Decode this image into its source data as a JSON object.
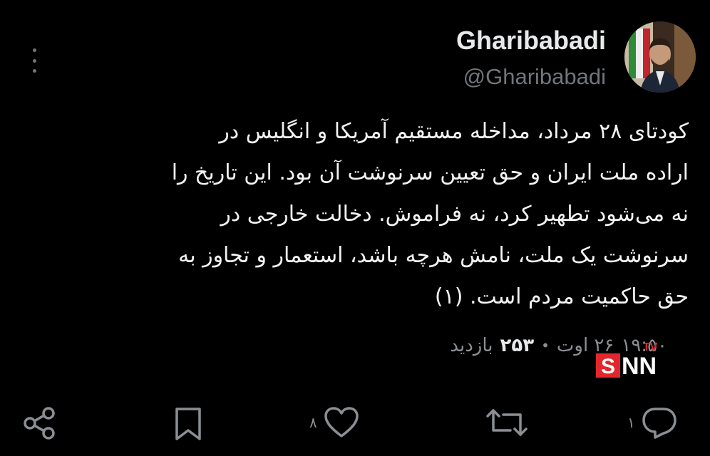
{
  "author": {
    "display_name": "Gharibabadi",
    "handle": "@Gharibabadi"
  },
  "tweet": {
    "lines": [
      "کودتای ۲۸ مرداد، مداخله مستقیم آمریکا و انگلیس در",
      "اراده ملت ایران و حق تعیین سرنوشت آن بود. این تاریخ را",
      "نه می‌شود تطهیر کرد، نه فراموش. دخالت خارجی در",
      "سرنوشت یک ملت، نامش هرچه باشد، استعمار و تجاوز به",
      "حق حاکمیت مردم است. (۱)"
    ]
  },
  "meta": {
    "time": "۱۹:۵۰",
    "date": "۲۶ اوت",
    "separator": "•",
    "views_count": "۲۵۳",
    "views_label": "بازدید"
  },
  "watermark": {
    "text": "SNN",
    "tv": "TV"
  },
  "actions": {
    "reply_count": "۱",
    "retweet_count": "",
    "like_count": "۸"
  },
  "icons": [
    "more-icon",
    "reply-icon",
    "retweet-icon",
    "like-icon",
    "bookmark-icon",
    "share-icon"
  ],
  "colors": {
    "background": "#000000",
    "text": "#e7e9ea",
    "muted": "#71767b",
    "logo_red": "#e3262b"
  }
}
